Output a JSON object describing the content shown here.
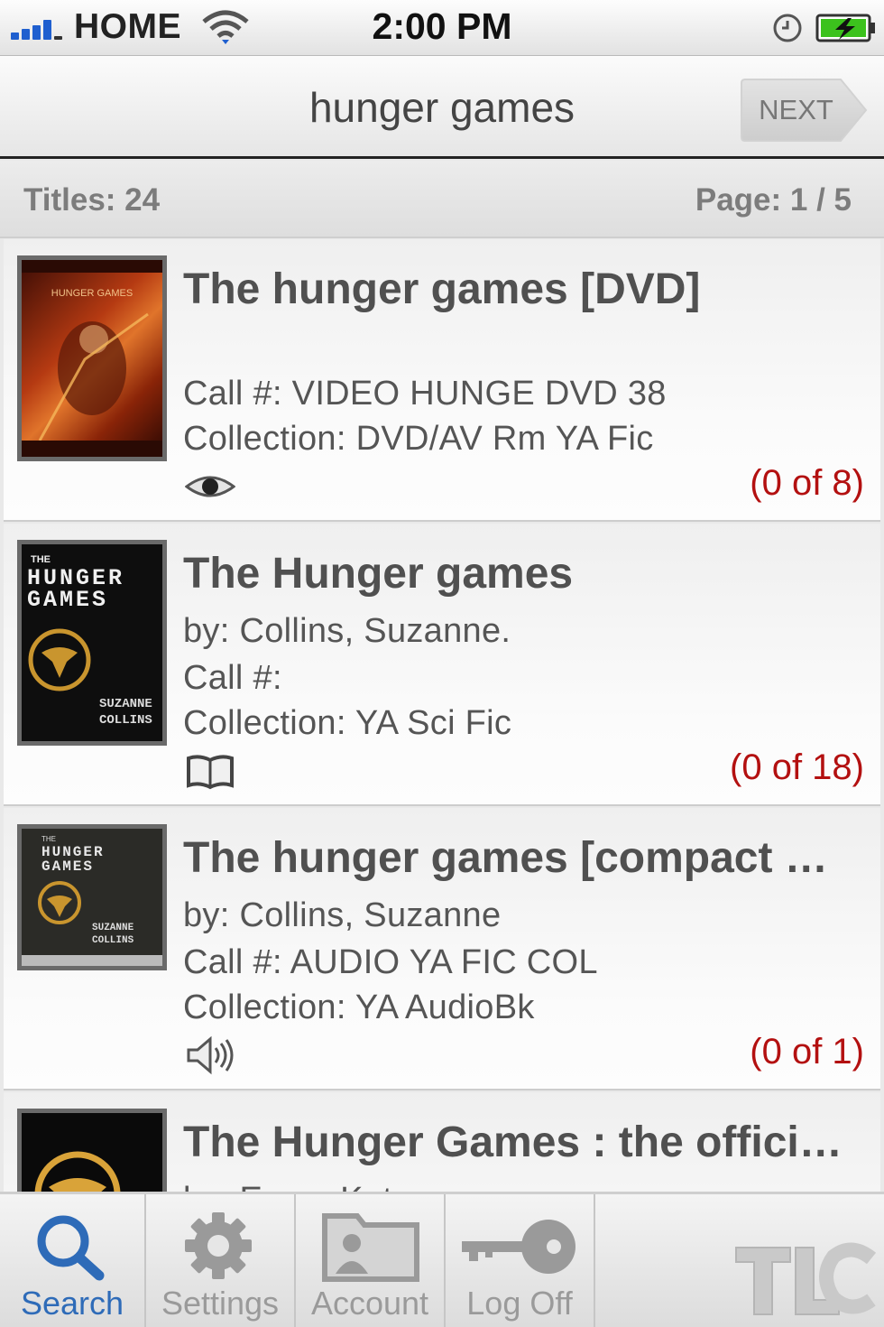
{
  "status_bar": {
    "carrier": "HOME",
    "time": "2:00 PM"
  },
  "nav": {
    "title": "hunger games",
    "next_label": "NEXT"
  },
  "info": {
    "titles": "Titles: 24",
    "page": "Page: 1 / 5"
  },
  "results": [
    {
      "title": "The hunger games [DVD]",
      "author": "",
      "call": "Call #: VIDEO HUNGE DVD 38",
      "collection": "Collection: DVD/AV Rm YA Fic",
      "format_icon": "eye-icon",
      "availability": "(0 of 8)"
    },
    {
      "title": "The Hunger games",
      "author": "by: Collins, Suzanne.",
      "call": "Call #:",
      "collection": "Collection: YA Sci Fic",
      "format_icon": "book-icon",
      "availability": "(0 of 18)"
    },
    {
      "title": "The hunger games [compact disc]",
      "author": "by: Collins, Suzanne",
      "call": "Call #: AUDIO YA FIC COL",
      "collection": "Collection: YA AudioBk",
      "format_icon": "speaker-icon",
      "availability": "(0 of 1)"
    },
    {
      "title": "The Hunger Games : the official illustrated movie companion",
      "author": "by: Egan, Kate"
    }
  ],
  "tabs": [
    {
      "label": "Search",
      "icon": "search-icon"
    },
    {
      "label": "Settings",
      "icon": "gear-icon"
    },
    {
      "label": "Account",
      "icon": "account-icon"
    },
    {
      "label": "Log Off",
      "icon": "key-icon"
    }
  ],
  "colors": {
    "availability": "#b31010",
    "active_tab": "#2e6bb8",
    "signal": "#1f5fcf",
    "battery": "#3cc21d"
  }
}
